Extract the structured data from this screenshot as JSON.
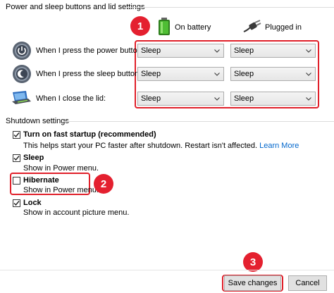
{
  "power_section": {
    "title": "Power and sleep buttons and lid settings",
    "col_battery": "On battery",
    "col_plugged": "Plugged in",
    "rows": [
      {
        "label": "When I press the power button:",
        "battery": "Sleep",
        "plugged": "Sleep"
      },
      {
        "label": "When I press the sleep button:",
        "battery": "Sleep",
        "plugged": "Sleep"
      },
      {
        "label": "When I close the lid:",
        "battery": "Sleep",
        "plugged": "Sleep"
      }
    ]
  },
  "shutdown_section": {
    "title": "Shutdown settings",
    "options": [
      {
        "label": "Turn on fast startup (recommended)",
        "desc": "This helps start your PC faster after shutdown. Restart isn't affected.",
        "link": "Learn More",
        "checked": true
      },
      {
        "label": "Sleep",
        "desc": "Show in Power menu.",
        "checked": true
      },
      {
        "label": "Hibernate",
        "desc": "Show in Power menu.",
        "checked": false
      },
      {
        "label": "Lock",
        "desc": "Show in account picture menu.",
        "checked": true
      }
    ]
  },
  "badges": [
    "1",
    "2",
    "3"
  ],
  "footer": {
    "save_label": "Save changes",
    "cancel_label": "Cancel"
  },
  "colors": {
    "highlight": "#e0202a",
    "badge": "#e4202f",
    "link": "#0066cc"
  },
  "icons": [
    "battery-icon",
    "plug-icon",
    "power-button-icon",
    "sleep-button-icon",
    "laptop-lid-icon",
    "chevron-down-icon",
    "checkmark-icon"
  ]
}
